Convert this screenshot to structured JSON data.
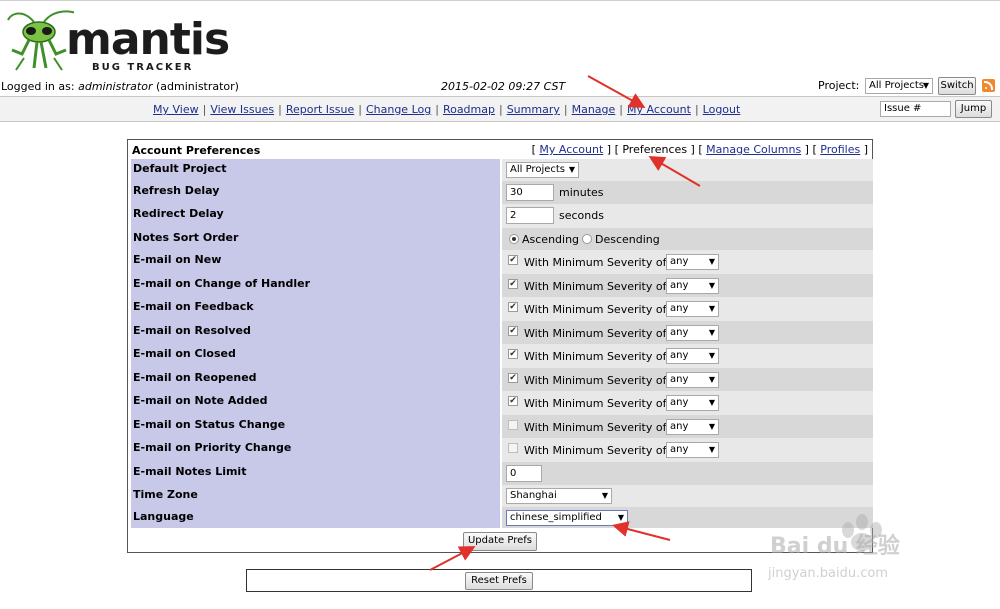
{
  "header": {
    "logo_text": "mantis",
    "logo_subtitle": "BUG TRACKER",
    "logged_in_prefix": "Logged in as:",
    "username": "administrator",
    "user_role": "(administrator)",
    "datetime": "2015-02-02 09:27 CST",
    "project_label": "Project:",
    "project_selected": "All Projects",
    "switch_label": "Switch"
  },
  "nav": {
    "items": [
      "My View",
      "View Issues",
      "Report Issue",
      "Change Log",
      "Roadmap",
      "Summary",
      "Manage",
      "My Account",
      "Logout"
    ],
    "issue_placeholder": "Issue #",
    "jump_label": "Jump"
  },
  "prefs": {
    "title": "Account Preferences",
    "tabs": [
      "My Account",
      "Preferences",
      "Manage Columns",
      "Profiles"
    ],
    "active_tab": "Preferences",
    "default_project": {
      "label": "Default Project",
      "value": "All Projects"
    },
    "refresh_delay": {
      "label": "Refresh Delay",
      "value": "30",
      "unit": "minutes"
    },
    "redirect_delay": {
      "label": "Redirect Delay",
      "value": "2",
      "unit": "seconds"
    },
    "notes_sort": {
      "label": "Notes Sort Order",
      "options": [
        "Ascending",
        "Descending"
      ],
      "selected": "Ascending"
    },
    "severity_text": "With Minimum Severity of",
    "email_rows": [
      {
        "label": "E-mail on New",
        "checked": true,
        "severity": "any"
      },
      {
        "label": "E-mail on Change of Handler",
        "checked": true,
        "severity": "any"
      },
      {
        "label": "E-mail on Feedback",
        "checked": true,
        "severity": "any"
      },
      {
        "label": "E-mail on Resolved",
        "checked": true,
        "severity": "any"
      },
      {
        "label": "E-mail on Closed",
        "checked": true,
        "severity": "any"
      },
      {
        "label": "E-mail on Reopened",
        "checked": true,
        "severity": "any"
      },
      {
        "label": "E-mail on Note Added",
        "checked": true,
        "severity": "any"
      },
      {
        "label": "E-mail on Status Change",
        "checked": false,
        "severity": "any"
      },
      {
        "label": "E-mail on Priority Change",
        "checked": false,
        "severity": "any"
      }
    ],
    "notes_limit": {
      "label": "E-mail Notes Limit",
      "value": "0"
    },
    "time_zone": {
      "label": "Time Zone",
      "value": "Shanghai"
    },
    "language": {
      "label": "Language",
      "value": "chinese_simplified"
    },
    "update_label": "Update Prefs",
    "reset_label": "Reset Prefs"
  },
  "watermark": {
    "text": "Bai du 经验",
    "sub": "jingyan.baidu.com"
  },
  "colors": {
    "label_bg": "#c8c8e8",
    "link": "#1f2f8f",
    "annotation": "#e0312a"
  }
}
